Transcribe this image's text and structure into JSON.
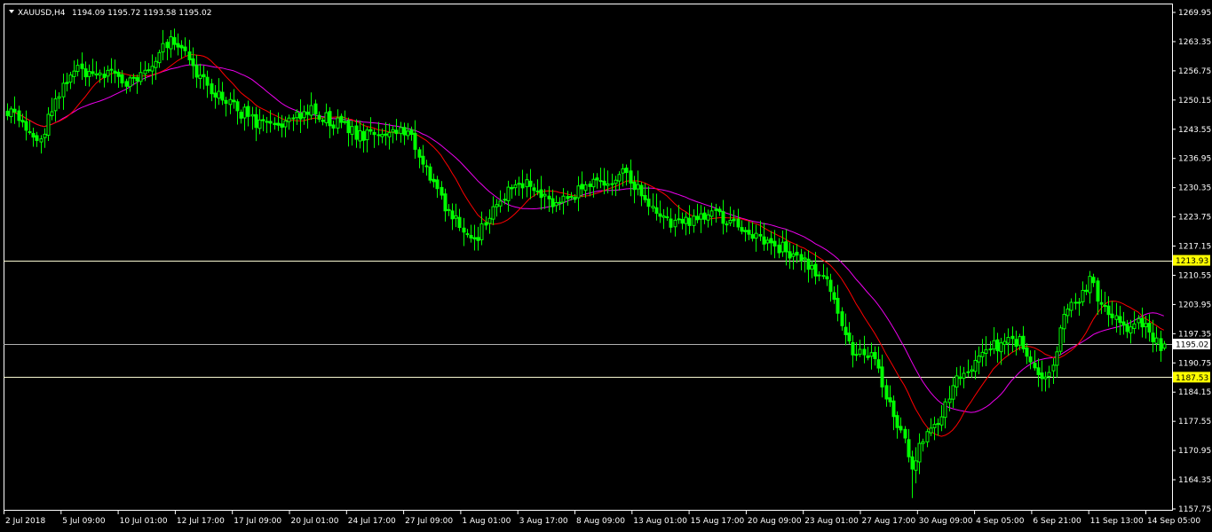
{
  "chart_header": {
    "symbol_label": "XAUUSD,H4",
    "ohlc_text": "1194.09 1195.72 1193.58 1195.02"
  },
  "colors": {
    "background": "#000000",
    "frame": "#ffffff",
    "bull_candle": "#00ff00",
    "bear_candle": "#00ff00",
    "ma_fast": "#ff0000",
    "ma_slow": "#ee00ee",
    "hline_yellow_tag": "#ffff00",
    "hline": "#fafad2",
    "price_tag_text": "#000000",
    "current_tag_bg": "#ffffff",
    "axis_text": "#ffffff"
  },
  "chart_data": {
    "type": "candlestick",
    "title": "XAUUSD,H4",
    "ylim": [
      1157.75,
      1272.5
    ],
    "y_ticks": [
      1269.95,
      1263.35,
      1256.75,
      1250.15,
      1243.55,
      1236.95,
      1230.35,
      1223.75,
      1217.15,
      1210.55,
      1203.95,
      1197.35,
      1190.75,
      1184.15,
      1177.55,
      1170.95,
      1164.35,
      1157.75
    ],
    "x_ticks": [
      "2 Jul 2018",
      "5 Jul 09:00",
      "10 Jul 01:00",
      "12 Jul 17:00",
      "17 Jul 09:00",
      "20 Jul 01:00",
      "24 Jul 17:00",
      "27 Jul 09:00",
      "1 Aug 01:00",
      "3 Aug 17:00",
      "8 Aug 09:00",
      "13 Aug 01:00",
      "15 Aug 17:00",
      "20 Aug 09:00",
      "23 Aug 01:00",
      "27 Aug 17:00",
      "30 Aug 09:00",
      "4 Sep 05:00",
      "6 Sep 21:00",
      "11 Sep 13:00",
      "14 Sep 05:00"
    ],
    "bar_count": 313,
    "horizontal_lines": [
      {
        "price": 1213.93,
        "label": "1213.93",
        "style": "yellow-tag"
      },
      {
        "price": 1195.02,
        "label": "1195.02",
        "style": "current-price"
      },
      {
        "price": 1187.53,
        "label": "1187.53",
        "style": "yellow-tag"
      }
    ],
    "close_path": [
      [
        0,
        1248.0
      ],
      [
        3,
        1242.0
      ],
      [
        6,
        1240.5
      ],
      [
        9,
        1251.0
      ],
      [
        12,
        1255.0
      ],
      [
        16,
        1257.5
      ],
      [
        20,
        1255.5
      ],
      [
        24,
        1254.0
      ],
      [
        28,
        1256.0
      ],
      [
        32,
        1255.0
      ],
      [
        36,
        1256.5
      ],
      [
        40,
        1255.0
      ],
      [
        44,
        1258.5
      ],
      [
        48,
        1262.0
      ],
      [
        51,
        1260.0
      ],
      [
        54,
        1258.0
      ],
      [
        57,
        1254.0
      ],
      [
        60,
        1255.5
      ],
      [
        63,
        1252.0
      ],
      [
        66,
        1250.0
      ],
      [
        70,
        1244.0
      ],
      [
        74,
        1245.0
      ],
      [
        78,
        1246.5
      ],
      [
        82,
        1248.0
      ],
      [
        86,
        1245.0
      ],
      [
        90,
        1241.0
      ],
      [
        94,
        1242.5
      ],
      [
        98,
        1244.0
      ],
      [
        102,
        1242.0
      ],
      [
        106,
        1240.5
      ],
      [
        110,
        1244.0
      ],
      [
        113,
        1232.0
      ],
      [
        116,
        1228.0
      ],
      [
        119,
        1226.0
      ],
      [
        122,
        1227.0
      ],
      [
        125,
        1224.0
      ],
      [
        128,
        1220.0
      ],
      [
        131,
        1222.0
      ],
      [
        134,
        1228.0
      ],
      [
        137,
        1226.0
      ],
      [
        140,
        1228.5
      ],
      [
        143,
        1231.0
      ],
      [
        146,
        1233.0
      ],
      [
        149,
        1231.0
      ],
      [
        152,
        1228.0
      ],
      [
        155,
        1226.0
      ],
      [
        158,
        1225.0
      ],
      [
        161,
        1224.0
      ],
      [
        164,
        1227.0
      ],
      [
        167,
        1229.0
      ],
      [
        170,
        1231.0
      ],
      [
        173,
        1233.0
      ],
      [
        176,
        1231.0
      ],
      [
        179,
        1227.0
      ],
      [
        182,
        1225.0
      ],
      [
        185,
        1223.0
      ],
      [
        188,
        1221.5
      ],
      [
        191,
        1222.0
      ],
      [
        194,
        1224.0
      ],
      [
        197,
        1223.0
      ],
      [
        200,
        1221.0
      ],
      [
        203,
        1219.0
      ],
      [
        206,
        1222.5
      ],
      [
        209,
        1224.5
      ],
      [
        212,
        1223.0
      ],
      [
        215,
        1221.0
      ],
      [
        218,
        1220.0
      ],
      [
        221,
        1218.0
      ],
      [
        224,
        1213.0
      ],
      [
        227,
        1208.0
      ],
      [
        230,
        1212.0
      ],
      [
        233,
        1215.5
      ],
      [
        236,
        1214.0
      ],
      [
        239,
        1211.0
      ],
      [
        242,
        1208.0
      ],
      [
        245,
        1209.0
      ],
      [
        248,
        1212.0
      ],
      [
        251,
        1211.0
      ],
      [
        254,
        1213.0
      ],
      [
        257,
        1212.0
      ],
      [
        260,
        1214.0
      ],
      [
        263,
        1213.0
      ],
      [
        266,
        1210.0
      ],
      [
        269,
        1212.0
      ],
      [
        272,
        1214.0
      ],
      [
        275,
        1212.0
      ],
      [
        278,
        1210.0
      ],
      [
        281,
        1208.0
      ],
      [
        284,
        1209.0
      ],
      [
        287,
        1211.0
      ],
      [
        290,
        1212.5
      ],
      [
        293,
        1210.0
      ],
      [
        296,
        1206.0
      ],
      [
        299,
        1202.0
      ],
      [
        302,
        1198.0
      ],
      [
        305,
        1193.0
      ],
      [
        308,
        1194.0
      ],
      [
        311,
        1195.0
      ],
      [
        313,
        1195.02
      ]
    ],
    "swing_path": [
      [
        0,
        1248.0
      ],
      [
        8,
        1240.0
      ],
      [
        18,
        1257.5
      ],
      [
        34,
        1254.5
      ],
      [
        46,
        1264.0
      ],
      [
        56,
        1252.0
      ],
      [
        72,
        1243.5
      ],
      [
        84,
        1247.5
      ],
      [
        98,
        1242.0
      ],
      [
        110,
        1244.0
      ],
      [
        120,
        1226.0
      ],
      [
        128,
        1218.0
      ],
      [
        140,
        1233.0
      ],
      [
        150,
        1226.0
      ],
      [
        162,
        1231.5
      ],
      [
        170,
        1233.5
      ],
      [
        182,
        1222.5
      ],
      [
        196,
        1224.0
      ],
      [
        208,
        1219.0
      ],
      [
        222,
        1212.0
      ],
      [
        238,
        1215.0
      ],
      [
        250,
        1210.5
      ],
      [
        262,
        1214.0
      ],
      [
        276,
        1212.5
      ],
      [
        288,
        1205.0
      ],
      [
        298,
        1193.0
      ],
      [
        308,
        1191.0
      ],
      [
        318,
        1194.0
      ]
    ],
    "segments": [
      {
        "from": 0,
        "to": 70,
        "open": 1248.0,
        "close": 1256.0,
        "hi": 1266.0,
        "lo": 1238.5
      },
      {
        "from": 70,
        "to": 112,
        "open": 1256.0,
        "close": 1243.0,
        "hi": 1256.0,
        "lo": 1237.0
      },
      {
        "from": 112,
        "to": 150,
        "open": 1243.0,
        "close": 1226.0,
        "hi": 1235.0,
        "lo": 1212.0
      },
      {
        "from": 150,
        "to": 200,
        "open": 1226.0,
        "close": 1224.0,
        "hi": 1235.5,
        "lo": 1215.0
      },
      {
        "from": 200,
        "to": 252,
        "open": 1224.0,
        "close": 1212.0,
        "hi": 1227.0,
        "lo": 1205.0
      },
      {
        "from": 252,
        "to": 288,
        "open": 1212.0,
        "close": 1207.0,
        "hi": 1216.0,
        "lo": 1202.0
      }
    ],
    "ohlc": [],
    "ma_fast": [],
    "ma_slow": []
  }
}
